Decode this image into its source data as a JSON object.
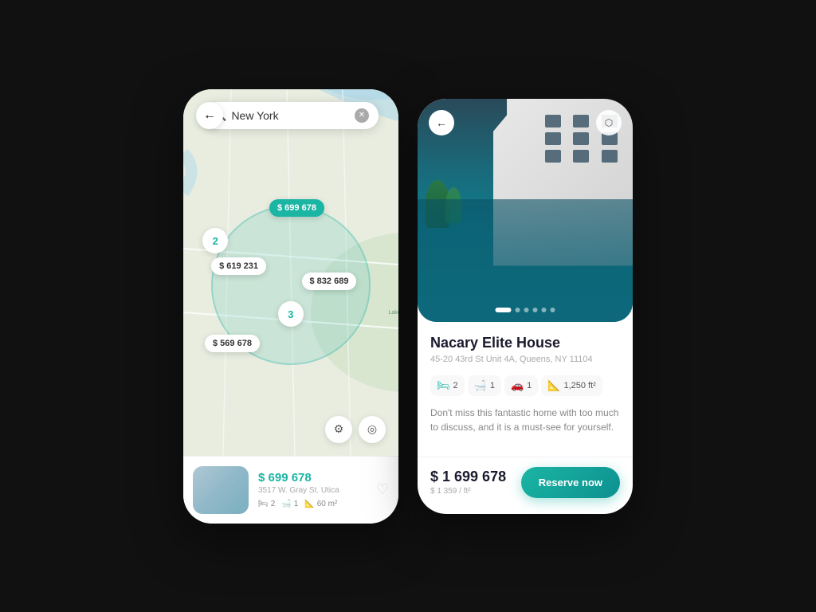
{
  "left_phone": {
    "search": {
      "placeholder": "New York",
      "value": "New York"
    },
    "back_label": "←",
    "price_tags": [
      {
        "id": "p1",
        "label": "$ 699 678",
        "active": true,
        "style": "top:30%; left:43%;"
      },
      {
        "id": "p2",
        "label": "$ 619 231",
        "active": false,
        "style": "top:46%; left:15%;"
      },
      {
        "id": "p3",
        "label": "$ 832 689",
        "active": false,
        "style": "top:52%; left:58%;"
      },
      {
        "id": "p4",
        "label": "$ 569 678",
        "active": false,
        "style": "top:68%; left:12%;"
      }
    ],
    "clusters": [
      {
        "id": "c1",
        "label": "2",
        "style": "top:36%; left:8%;"
      },
      {
        "id": "c2",
        "label": "3",
        "style": "top:60%; left:43%;"
      }
    ],
    "map_card": {
      "price": "$ 699 678",
      "address": "3517 W. Gray St. Utica",
      "beds": "2",
      "baths": "1",
      "area": "60 m²"
    },
    "controls": {
      "filter_icon": "⚙",
      "location_icon": "◎"
    }
  },
  "right_phone": {
    "back_label": "←",
    "view3d_label": "⬡",
    "dots": [
      {
        "active": true
      },
      {
        "active": false
      },
      {
        "active": false
      },
      {
        "active": false
      },
      {
        "active": false
      },
      {
        "active": false
      }
    ],
    "title": "Nacary Elite House",
    "address": "45-20 43rd St Unit 4A, Queens, NY 11104",
    "features": [
      {
        "icon": "🛏",
        "value": "2"
      },
      {
        "icon": "🛁",
        "value": "1"
      },
      {
        "icon": "🚗",
        "value": "1"
      },
      {
        "icon": "📐",
        "value": "1,250 ft²"
      }
    ],
    "description": "Don't miss this fantastic home with too much to discuss, and it is a must-see for yourself.",
    "price_main": "$ 1 699 678",
    "price_sub": "$ 1 359 / ft²",
    "reserve_btn": "Reserve now"
  }
}
